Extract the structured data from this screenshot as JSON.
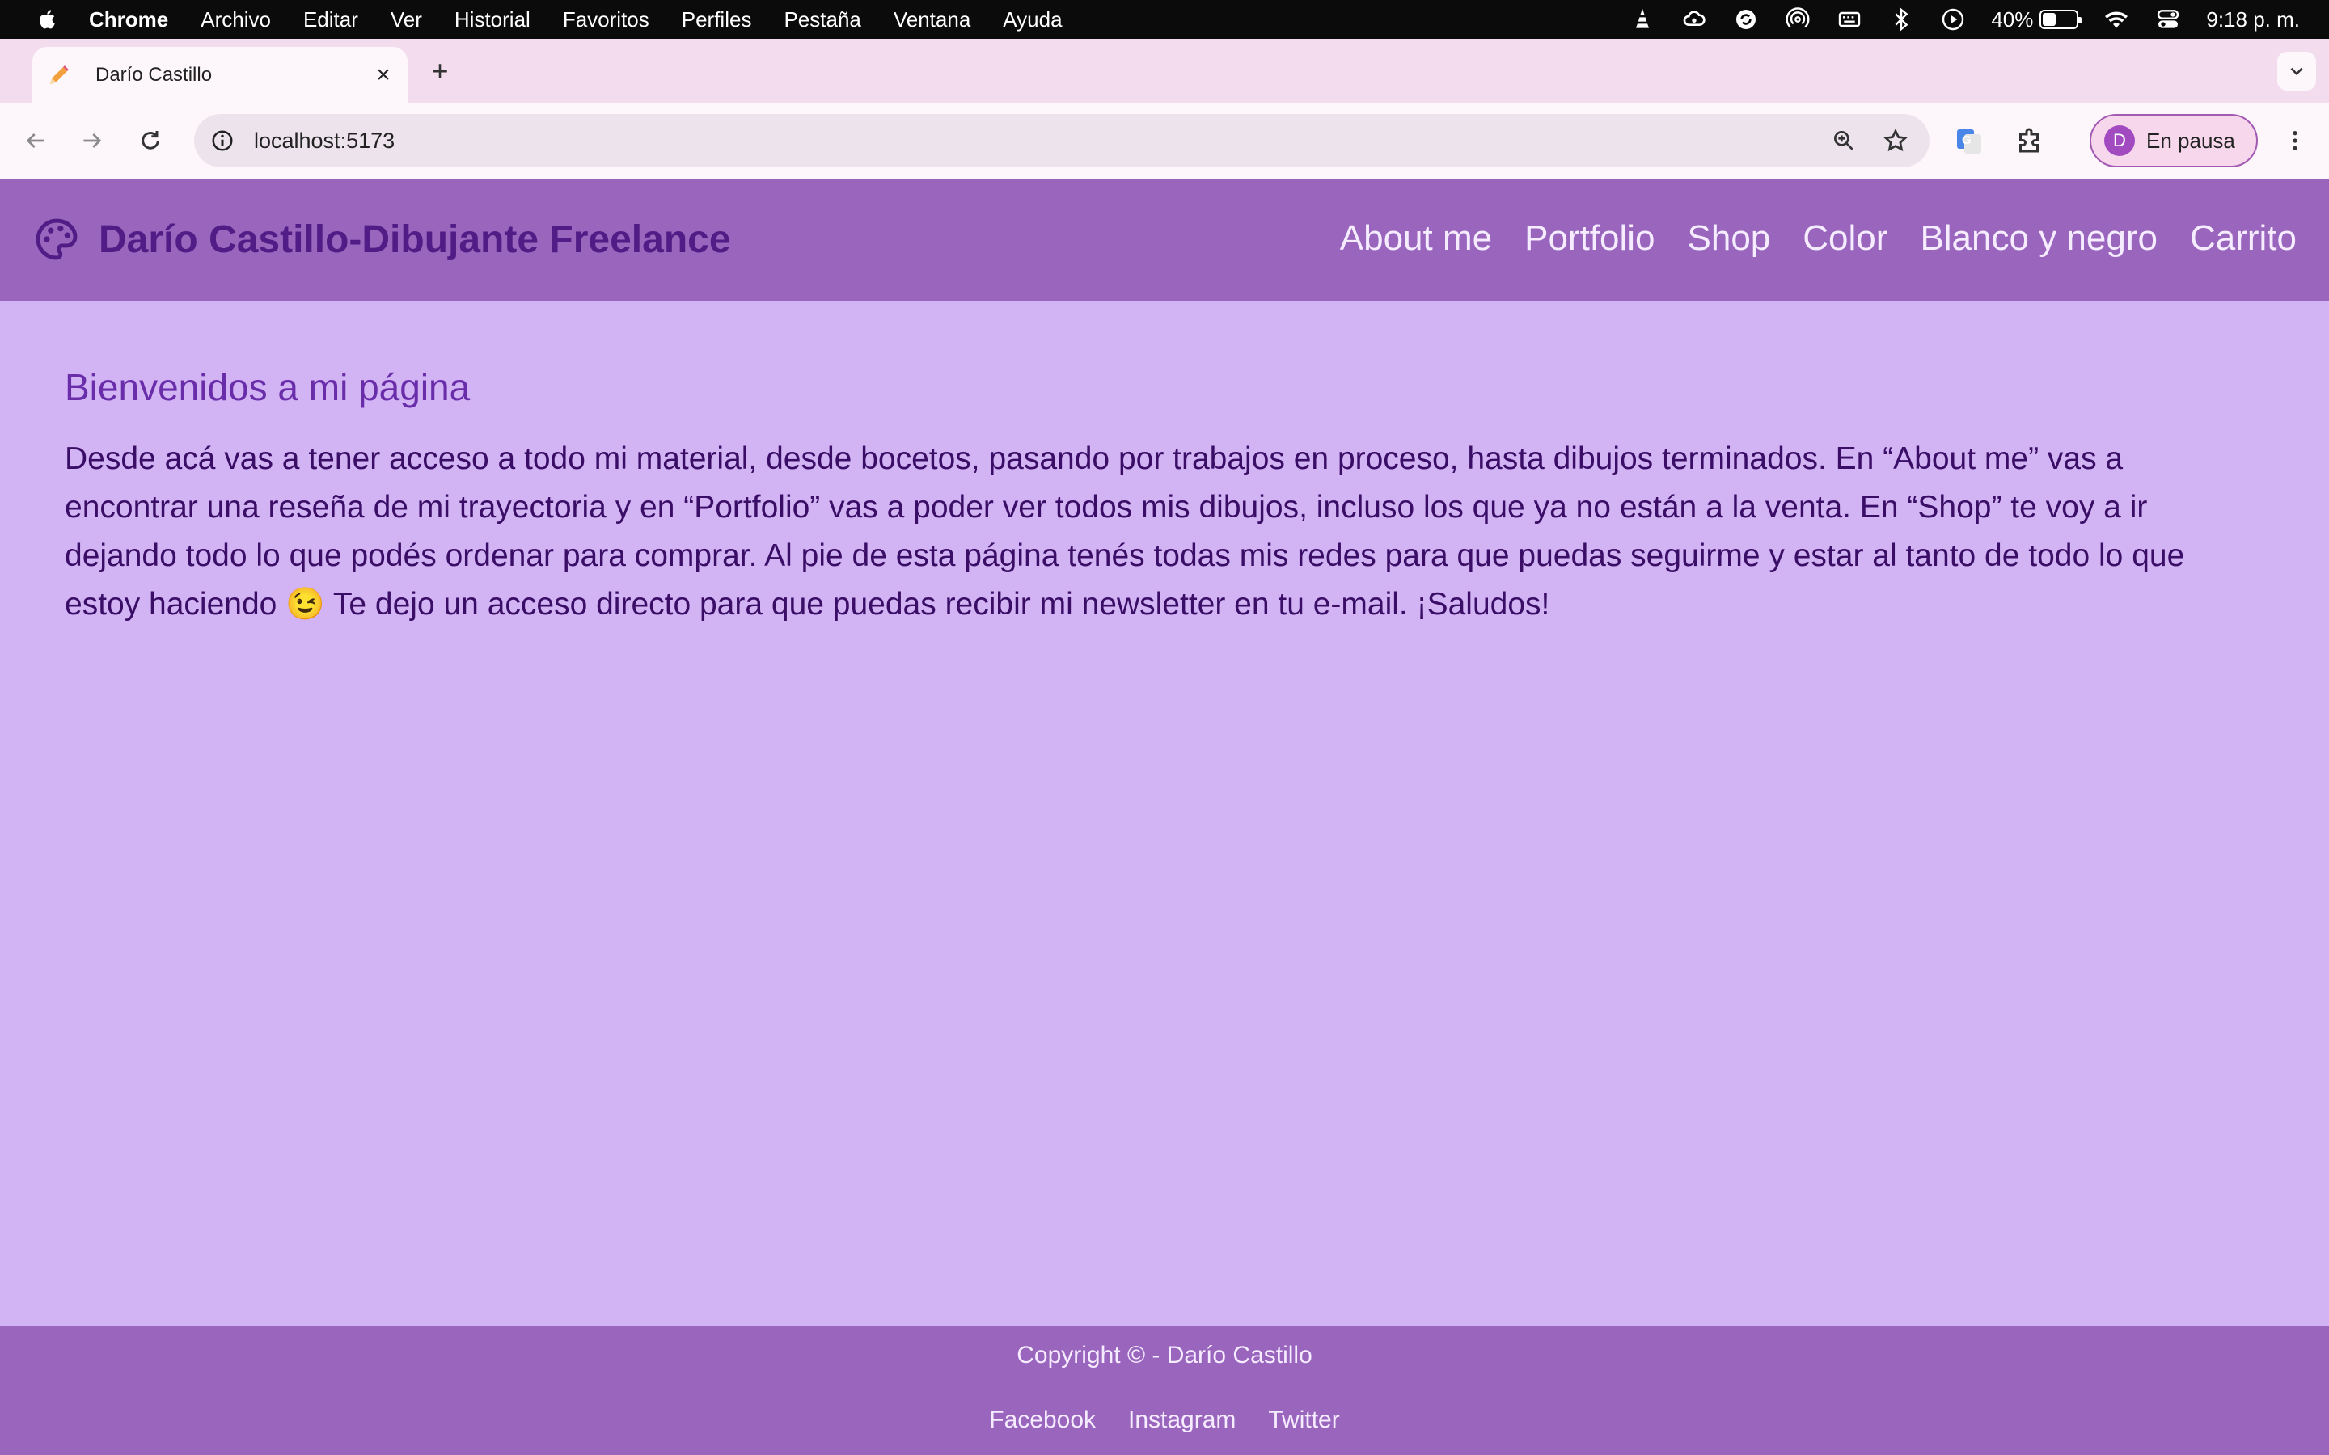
{
  "menubar": {
    "app_name": "Chrome",
    "items": [
      "Archivo",
      "Editar",
      "Ver",
      "Historial",
      "Favoritos",
      "Perfiles",
      "Pestaña",
      "Ventana",
      "Ayuda"
    ],
    "battery_percent": "40%",
    "battery_level": 0.4,
    "clock": "9:18 p. m."
  },
  "browser": {
    "tab_title": "Darío Castillo",
    "url": "localhost:5173",
    "profile_initial": "D",
    "profile_status": "En pausa"
  },
  "site": {
    "brand": "Darío Castillo-Dibujante Freelance",
    "nav": [
      "About me",
      "Portfolio",
      "Shop",
      "Color",
      "Blanco y negro",
      "Carrito"
    ]
  },
  "main": {
    "heading": "Bienvenidos a mi página",
    "body": "Desde acá vas a tener acceso a todo mi material, desde bocetos, pasando por trabajos en proceso, hasta dibujos terminados. En “About me” vas a encontrar una reseña de mi trayectoria y en “Portfolio” vas a poder ver todos mis dibujos, incluso los que ya no están a la venta. En “Shop” te voy a ir dejando todo lo que podés ordenar para comprar. Al pie de esta página tenés todas mis redes para que puedas seguirme y estar al tanto de todo lo que estoy haciendo 😉 Te dejo un acceso directo para que puedas recibir mi newsletter en tu e-mail. ¡Saludos!"
  },
  "footer": {
    "copyright": "Copyright © - Darío Castillo",
    "links": [
      "Facebook",
      "Instagram",
      "Twitter"
    ]
  },
  "colors": {
    "page_background": "#d2b4f5",
    "header_footer": "#9965bd",
    "brand_text": "#521c86",
    "heading": "#6a2daa",
    "body_text": "#3a0d66"
  }
}
